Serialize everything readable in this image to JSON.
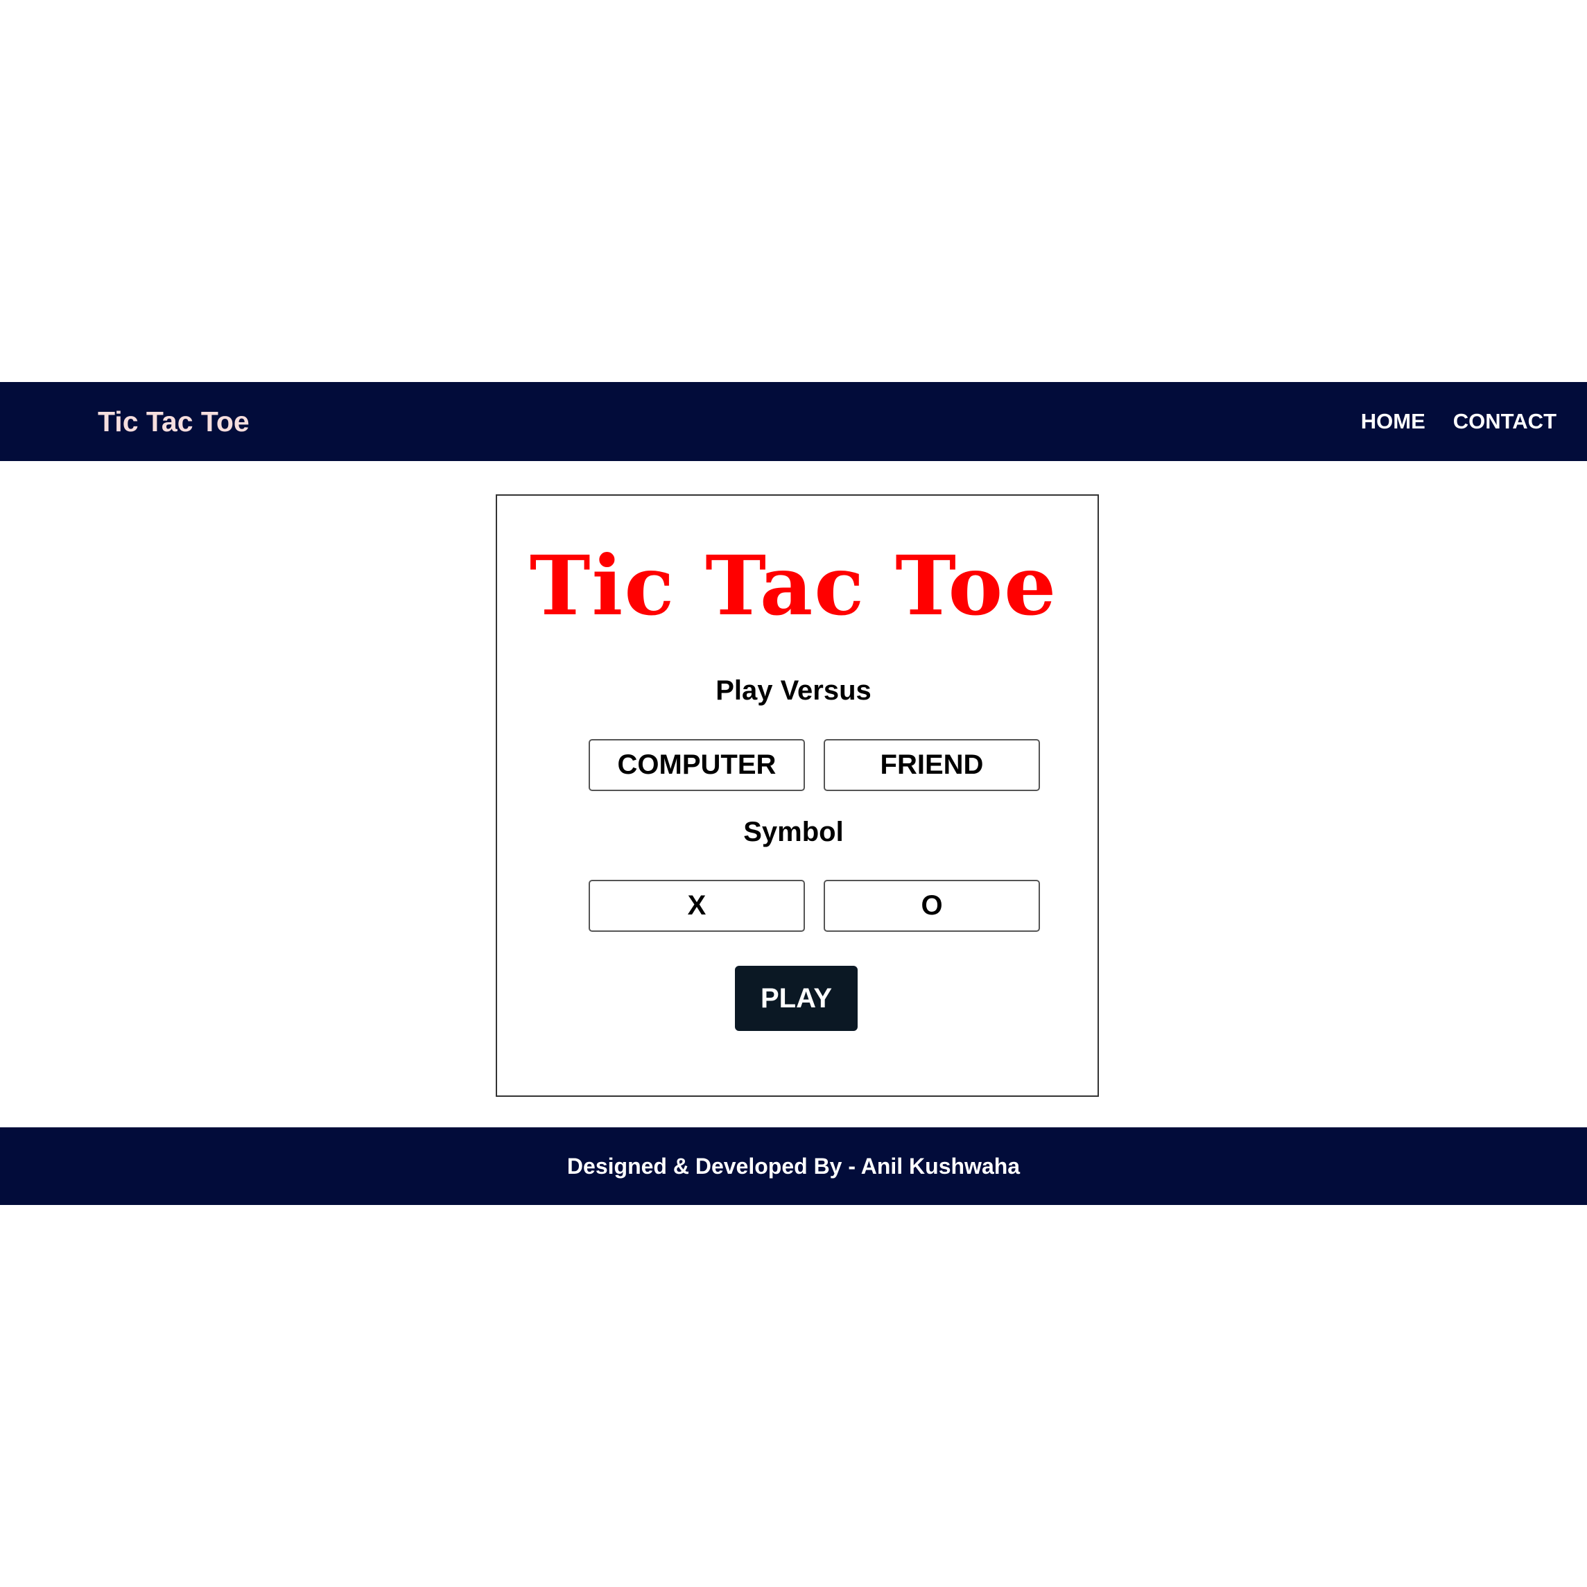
{
  "navbar": {
    "brand": "Tic Tac Toe",
    "links": [
      {
        "label": "HOME"
      },
      {
        "label": "CONTACT"
      }
    ]
  },
  "game": {
    "title": "Tic Tac Toe",
    "versus_label": "Play Versus",
    "versus_options": [
      "COMPUTER",
      "FRIEND"
    ],
    "symbol_label": "Symbol",
    "symbol_options": [
      "X",
      "O"
    ],
    "play_label": "PLAY"
  },
  "footer": {
    "credit": "Designed & Developed By - Anil Kushwaha"
  },
  "colors": {
    "navbar_bg": "#020c3a",
    "title_red": "#ff0000",
    "play_button_bg": "#0b1824"
  }
}
